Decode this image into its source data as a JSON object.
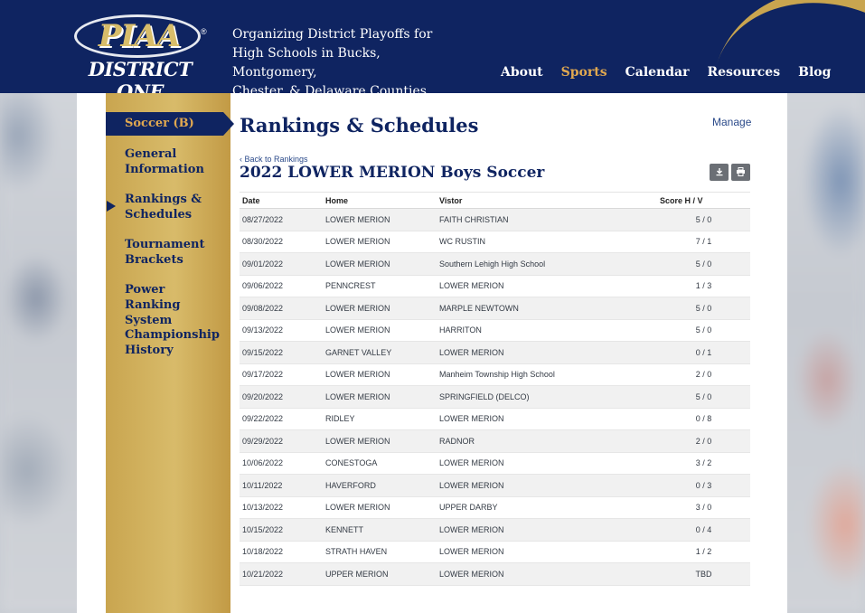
{
  "header": {
    "logo_top": "PIAA",
    "logo_bottom": "DISTRICT ONE",
    "tagline_lines": [
      "Organizing District Playoffs for",
      "High Schools in Bucks, Montgomery,",
      "Chester, & Delaware Counties."
    ],
    "nav": [
      "About",
      "Sports",
      "Calendar",
      "Resources",
      "Blog"
    ],
    "active_nav": "Sports"
  },
  "sidebar": {
    "active_label": "Soccer (B)",
    "items": [
      "General Information",
      "Rankings & Schedules",
      "Tournament Brackets",
      "Power Ranking System",
      "Championship History"
    ]
  },
  "main": {
    "title": "Rankings & Schedules",
    "manage_label": "Manage",
    "back_label": "‹ Back to Rankings",
    "schedule_title": "2022 LOWER MERION Boys Soccer",
    "download_icon": "download-icon",
    "print_icon": "print-icon"
  },
  "table": {
    "headers": [
      "Date",
      "Home",
      "Vistor",
      "Score H / V"
    ],
    "rows": [
      [
        "08/27/2022",
        "LOWER MERION",
        "FAITH CHRISTIAN",
        "5 / 0"
      ],
      [
        "08/30/2022",
        "LOWER MERION",
        "WC RUSTIN",
        "7 / 1"
      ],
      [
        "09/01/2022",
        "LOWER MERION",
        "Southern Lehigh High School",
        "5 / 0"
      ],
      [
        "09/06/2022",
        "PENNCREST",
        "LOWER MERION",
        "1 / 3"
      ],
      [
        "09/08/2022",
        "LOWER MERION",
        "MARPLE NEWTOWN",
        "5 / 0"
      ],
      [
        "09/13/2022",
        "LOWER MERION",
        "HARRITON",
        "5 / 0"
      ],
      [
        "09/15/2022",
        "GARNET VALLEY",
        "LOWER MERION",
        "0 / 1"
      ],
      [
        "09/17/2022",
        "LOWER MERION",
        "Manheim Township High School",
        "2 / 0"
      ],
      [
        "09/20/2022",
        "LOWER MERION",
        "SPRINGFIELD (DELCO)",
        "5 / 0"
      ],
      [
        "09/22/2022",
        "RIDLEY",
        "LOWER MERION",
        "0 / 8"
      ],
      [
        "09/29/2022",
        "LOWER MERION",
        "RADNOR",
        "2 / 0"
      ],
      [
        "10/06/2022",
        "CONESTOGA",
        "LOWER MERION",
        "3 / 2"
      ],
      [
        "10/11/2022",
        "HAVERFORD",
        "LOWER MERION",
        "0 / 3"
      ],
      [
        "10/13/2022",
        "LOWER MERION",
        "UPPER DARBY",
        "3 / 0"
      ],
      [
        "10/15/2022",
        "KENNETT",
        "LOWER MERION",
        "0 / 4"
      ],
      [
        "10/18/2022",
        "STRATH HAVEN",
        "LOWER MERION",
        "1 / 2"
      ],
      [
        "10/21/2022",
        "UPPER MERION",
        "LOWER MERION",
        "TBD"
      ]
    ]
  }
}
